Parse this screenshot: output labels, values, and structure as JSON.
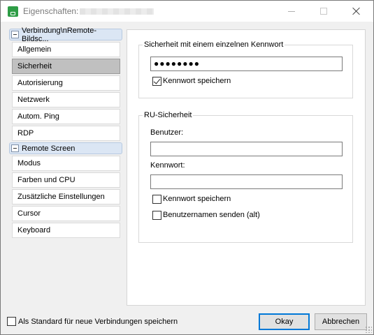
{
  "window": {
    "title": "Eigenschaften:"
  },
  "sidebar": {
    "groups": [
      {
        "label": "Verbindung\\nRemote-Bildsc...",
        "items": [
          "Allgemein",
          "Sicherheit",
          "Autorisierung",
          "Netzwerk",
          "Autom. Ping",
          "RDP"
        ],
        "selected": "Sicherheit"
      },
      {
        "label": "Remote Screen",
        "items": [
          "Modus",
          "Farben und CPU",
          "Zusätzliche Einstellungen",
          "Cursor",
          "Keyboard"
        ]
      }
    ]
  },
  "single_password": {
    "title": "Sicherheit mit einem einzelnen Kennwort",
    "password_value": "●●●●●●●●",
    "save_password_label": "Kennwort speichern",
    "save_password_checked": true
  },
  "ru_security": {
    "title": "RU-Sicherheit",
    "user_label": "Benutzer:",
    "user_value": "",
    "password_label": "Kennwort:",
    "password_value": "",
    "save_password_label": "Kennwort speichern",
    "save_password_checked": false,
    "send_username_label": "Benutzernamen senden (alt)",
    "send_username_checked": false
  },
  "footer": {
    "default_label": "Als Standard für neue Verbindungen speichern",
    "default_checked": false,
    "ok_label": "Okay",
    "cancel_label": "Abbrechen"
  },
  "colors": {
    "accent": "#0078d7",
    "app_icon": "#2e9d46",
    "selected_item": "#c0c0c0",
    "group_header": "#dbe6f4"
  }
}
